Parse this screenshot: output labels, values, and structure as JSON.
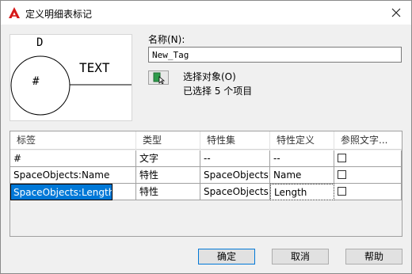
{
  "window": {
    "title": "定义明细表标记"
  },
  "preview": {
    "top_letter": "D",
    "tag_symbol": "#",
    "tag_text": "TEXT"
  },
  "name_field": {
    "label": "名称(N):",
    "value": "New_Tag"
  },
  "select_objects": {
    "label": "选择对象(O)",
    "status": "已选择 5 个项目"
  },
  "table": {
    "columns": [
      "标签",
      "类型",
      "特性集",
      "特性定义",
      "参照文字..."
    ],
    "rows": [
      {
        "tag": "#",
        "type": "文字",
        "set": "--",
        "def": "--",
        "ref_checked": false
      },
      {
        "tag": "SpaceObjects:Name",
        "type": "特性",
        "set": "SpaceObjects",
        "def": "Name",
        "ref_checked": false
      },
      {
        "tag": "SpaceObjects:Length",
        "type": "特性",
        "set": "SpaceObjects",
        "def": "Length",
        "ref_checked": false
      }
    ]
  },
  "buttons": {
    "ok": "确定",
    "cancel": "取消",
    "help": "帮助"
  },
  "colors": {
    "selection": "#0078d7",
    "app_icon": "#d61a1a",
    "select_icon": "#2e9b4b"
  }
}
